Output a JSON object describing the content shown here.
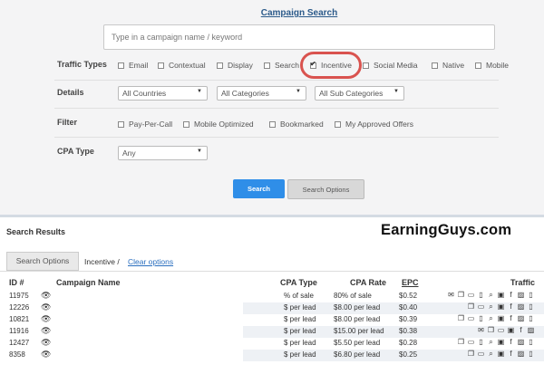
{
  "search": {
    "title": "Campaign Search",
    "placeholder": "Type in a campaign name / keyword"
  },
  "traffic_types": {
    "label": "Traffic Types",
    "options": [
      {
        "label": "Email",
        "checked": false
      },
      {
        "label": "Contextual",
        "checked": false
      },
      {
        "label": "Display",
        "checked": false
      },
      {
        "label": "Search",
        "checked": false
      },
      {
        "label": "Incentive",
        "checked": true
      },
      {
        "label": "Social Media",
        "checked": false
      },
      {
        "label": "Native",
        "checked": false
      },
      {
        "label": "Mobile",
        "checked": false
      }
    ]
  },
  "details": {
    "label": "Details",
    "countries": "All Countries",
    "categories": "All Categories",
    "sub_categories": "All Sub Categories"
  },
  "filter": {
    "label": "Filter",
    "options": [
      {
        "label": "Pay-Per-Call",
        "checked": false
      },
      {
        "label": "Mobile Optimized",
        "checked": false
      },
      {
        "label": "Bookmarked",
        "checked": false
      },
      {
        "label": "My Approved Offers",
        "checked": false
      }
    ]
  },
  "cpa_type": {
    "label": "CPA Type",
    "value": "Any"
  },
  "buttons": {
    "search": "Search",
    "search_options": "Search Options"
  },
  "results": {
    "title": "Search Results",
    "tab": "Search Options",
    "active_filter": "Incentive /",
    "clear": "Clear options",
    "columns": {
      "id": "ID #",
      "name": "Campaign Name",
      "cpa_type": "CPA Type",
      "cpa_rate": "CPA Rate",
      "epc": "EPC",
      "traffic": "Traffic"
    },
    "rows": [
      {
        "id": "11975",
        "cpa_type": "% of sale",
        "cpa_rate": "80% of sale",
        "epc": "$0.52",
        "icons": [
          "email-icon",
          "windows-icon",
          "monitor-icon",
          "mobile-icon",
          "search-icon",
          "money-icon",
          "facebook-icon",
          "image-icon",
          "mobile-icon"
        ]
      },
      {
        "id": "12226",
        "cpa_type": "$ per lead",
        "cpa_rate": "$8.00 per lead",
        "epc": "$0.40",
        "icons": [
          "windows-icon",
          "monitor-icon",
          "search-icon",
          "money-icon",
          "facebook-icon",
          "image-icon",
          "mobile-icon"
        ]
      },
      {
        "id": "10821",
        "cpa_type": "$ per lead",
        "cpa_rate": "$8.00 per lead",
        "epc": "$0.39",
        "icons": [
          "windows-icon",
          "monitor-icon",
          "mobile-icon",
          "search-icon",
          "money-icon",
          "facebook-icon",
          "image-icon",
          "mobile-icon"
        ]
      },
      {
        "id": "11916",
        "cpa_type": "$ per lead",
        "cpa_rate": "$15.00 per lead",
        "epc": "$0.38",
        "icons": [
          "email-icon",
          "windows-icon",
          "monitor-icon",
          "money-icon",
          "facebook-icon",
          "image-icon"
        ]
      },
      {
        "id": "12427",
        "cpa_type": "$ per lead",
        "cpa_rate": "$5.50 per lead",
        "epc": "$0.28",
        "icons": [
          "windows-icon",
          "monitor-icon",
          "mobile-icon",
          "search-icon",
          "money-icon",
          "facebook-icon",
          "image-icon",
          "mobile-icon"
        ]
      },
      {
        "id": "8358",
        "cpa_type": "$ per lead",
        "cpa_rate": "$6.80 per lead",
        "epc": "$0.25",
        "icons": [
          "windows-icon",
          "monitor-icon",
          "search-icon",
          "money-icon",
          "facebook-icon",
          "image-icon",
          "mobile-icon"
        ]
      }
    ]
  },
  "watermark": "EarningGuys.com",
  "colors": {
    "accent": "#2f8ee8",
    "highlight_circle": "#d9534f",
    "link": "#2b6fbf"
  }
}
